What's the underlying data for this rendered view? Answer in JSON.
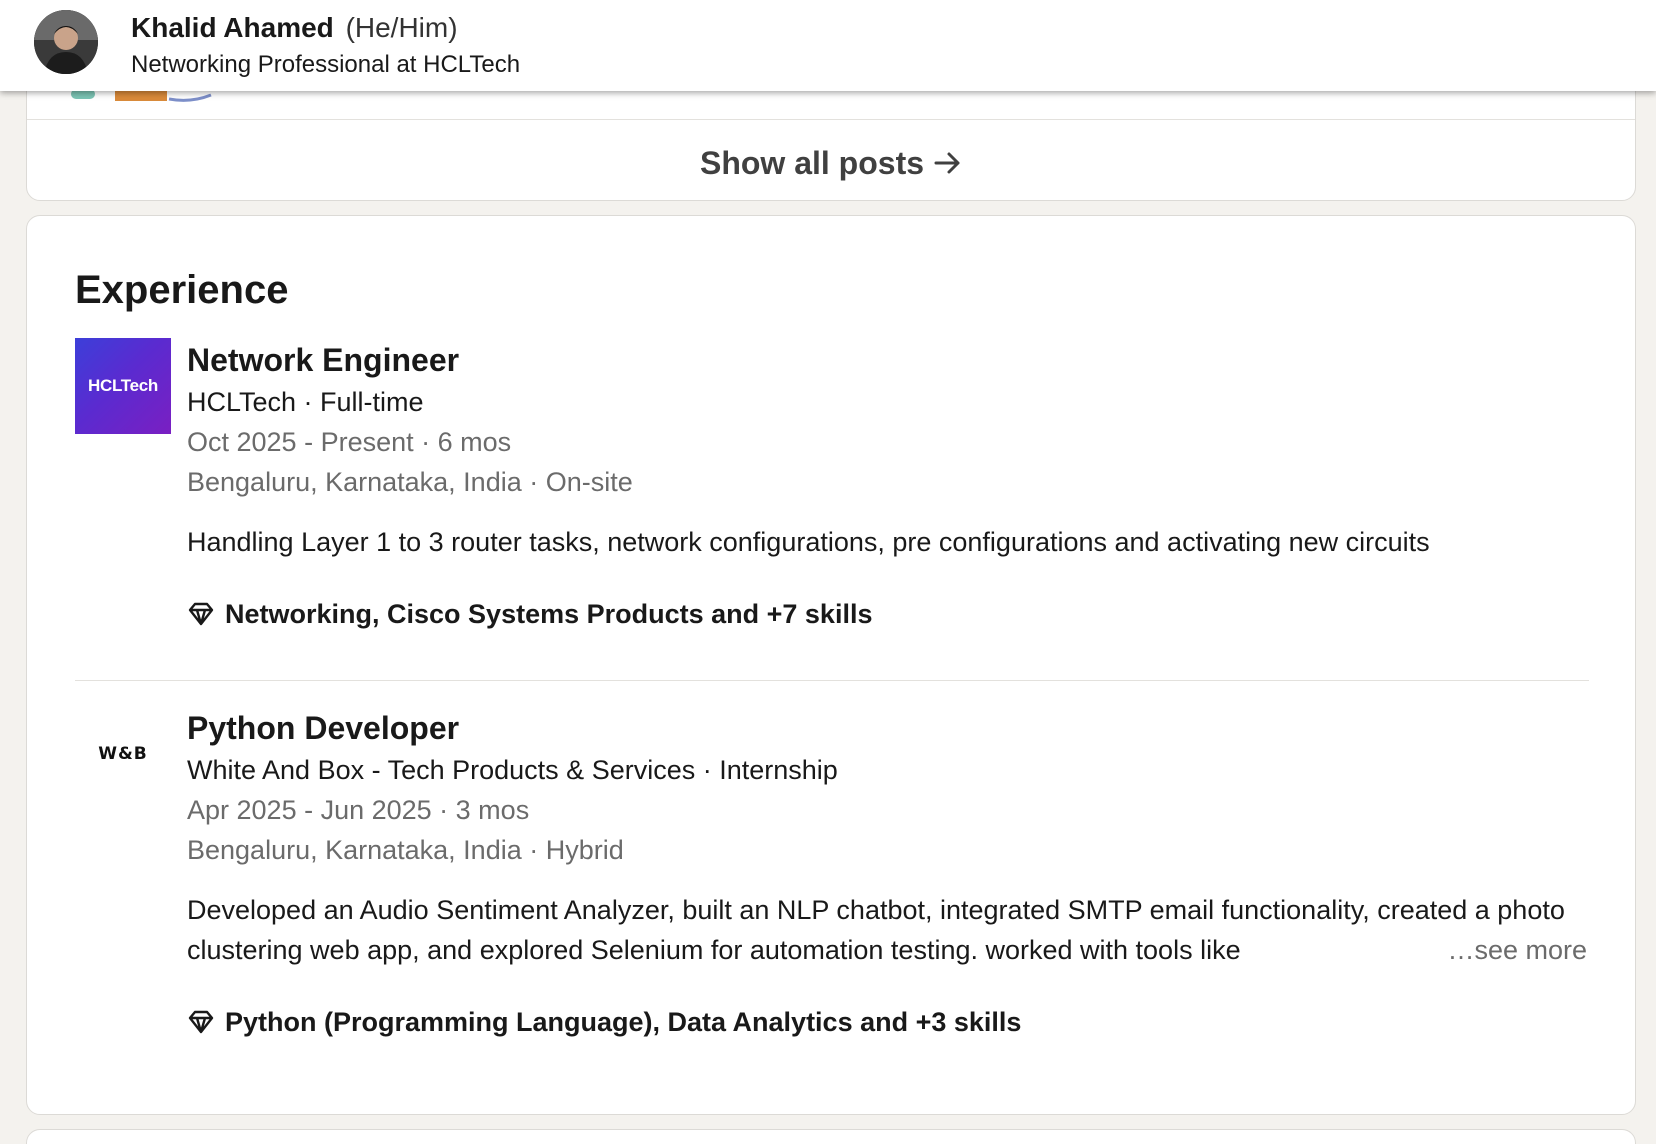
{
  "header": {
    "name": "Khalid Ahamed",
    "pronouns": "(He/Him)",
    "headline": "Networking Professional at HCLTech"
  },
  "posts": {
    "show_all_label": "Show all posts"
  },
  "experience": {
    "title": "Experience",
    "items": [
      {
        "logo_text": "HCLTech",
        "title": "Network Engineer",
        "company": "HCLTech · Full-time",
        "dates": "Oct 2025 - Present · 6 mos",
        "location": "Bengaluru, Karnataka, India · On-site",
        "description": "Handling Layer 1 to 3 router tasks, network configurations, pre configurations and activating new circuits",
        "skills": "Networking, Cisco Systems Products and +7 skills"
      },
      {
        "logo_text": "W&B",
        "title": "Python Developer",
        "company": "White And Box - Tech Products & Services · Internship",
        "dates": "Apr 2025 - Jun 2025 · 3 mos",
        "location": "Bengaluru, Karnataka, India · Hybrid",
        "description": "Developed an Audio Sentiment Analyzer, built an NLP chatbot, integrated SMTP email functionality, created a photo clustering web app, and explored Selenium for automation testing. worked with tools like",
        "see_more": "…see more",
        "skills": "Python (Programming Language), Data Analytics and +3 skills"
      }
    ]
  },
  "colors": {
    "background": "#f4f2ee",
    "card": "#ffffff",
    "text": "#191919",
    "muted": "#6b6b6b"
  }
}
